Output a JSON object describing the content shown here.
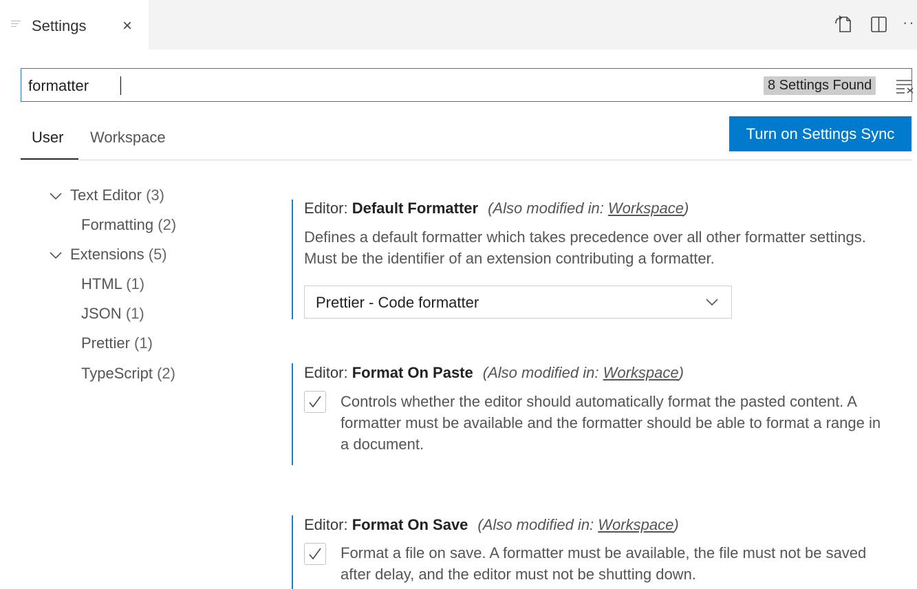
{
  "tab": {
    "title": "Settings",
    "close": "×"
  },
  "toolbar": {
    "more": "··"
  },
  "search": {
    "value": "formatter",
    "results": "8 Settings Found"
  },
  "scope_tabs": {
    "user": "User",
    "workspace": "Workspace"
  },
  "sync_button": "Turn on Settings Sync",
  "toc": [
    {
      "label": "Text Editor",
      "count": "(3)"
    },
    {
      "label": "Formatting",
      "count": "(2)"
    },
    {
      "label": "Extensions",
      "count": "(5)"
    },
    {
      "label": "HTML",
      "count": "(1)"
    },
    {
      "label": "JSON",
      "count": "(1)"
    },
    {
      "label": "Prettier",
      "count": "(1)"
    },
    {
      "label": "TypeScript",
      "count": "(2)"
    }
  ],
  "settings": [
    {
      "category": "Editor: ",
      "name": "Default Formatter",
      "modified_prefix": "(Also modified in: ",
      "modified_link": "Workspace",
      "modified_suffix": ")",
      "description": "Defines a default formatter which takes precedence over all other formatter settings. Must be the identifier of an extension contributing a formatter.",
      "value": "Prettier - Code formatter"
    },
    {
      "category": "Editor: ",
      "name": "Format On Paste",
      "modified_prefix": "(Also modified in: ",
      "modified_link": "Workspace",
      "modified_suffix": ")",
      "description": "Controls whether the editor should automatically format the pasted content. A formatter must be available and the formatter should be able to format a range in a document.",
      "checked": true
    },
    {
      "category": "Editor: ",
      "name": "Format On Save",
      "modified_prefix": "(Also modified in: ",
      "modified_link": "Workspace",
      "modified_suffix": ")",
      "description": "Format a file on save. A formatter must be available, the file must not be saved after delay, and the editor must not be shutting down.",
      "checked": true
    }
  ],
  "colors": {
    "accent": "#007acc",
    "focus_border": "#1b81c4"
  }
}
